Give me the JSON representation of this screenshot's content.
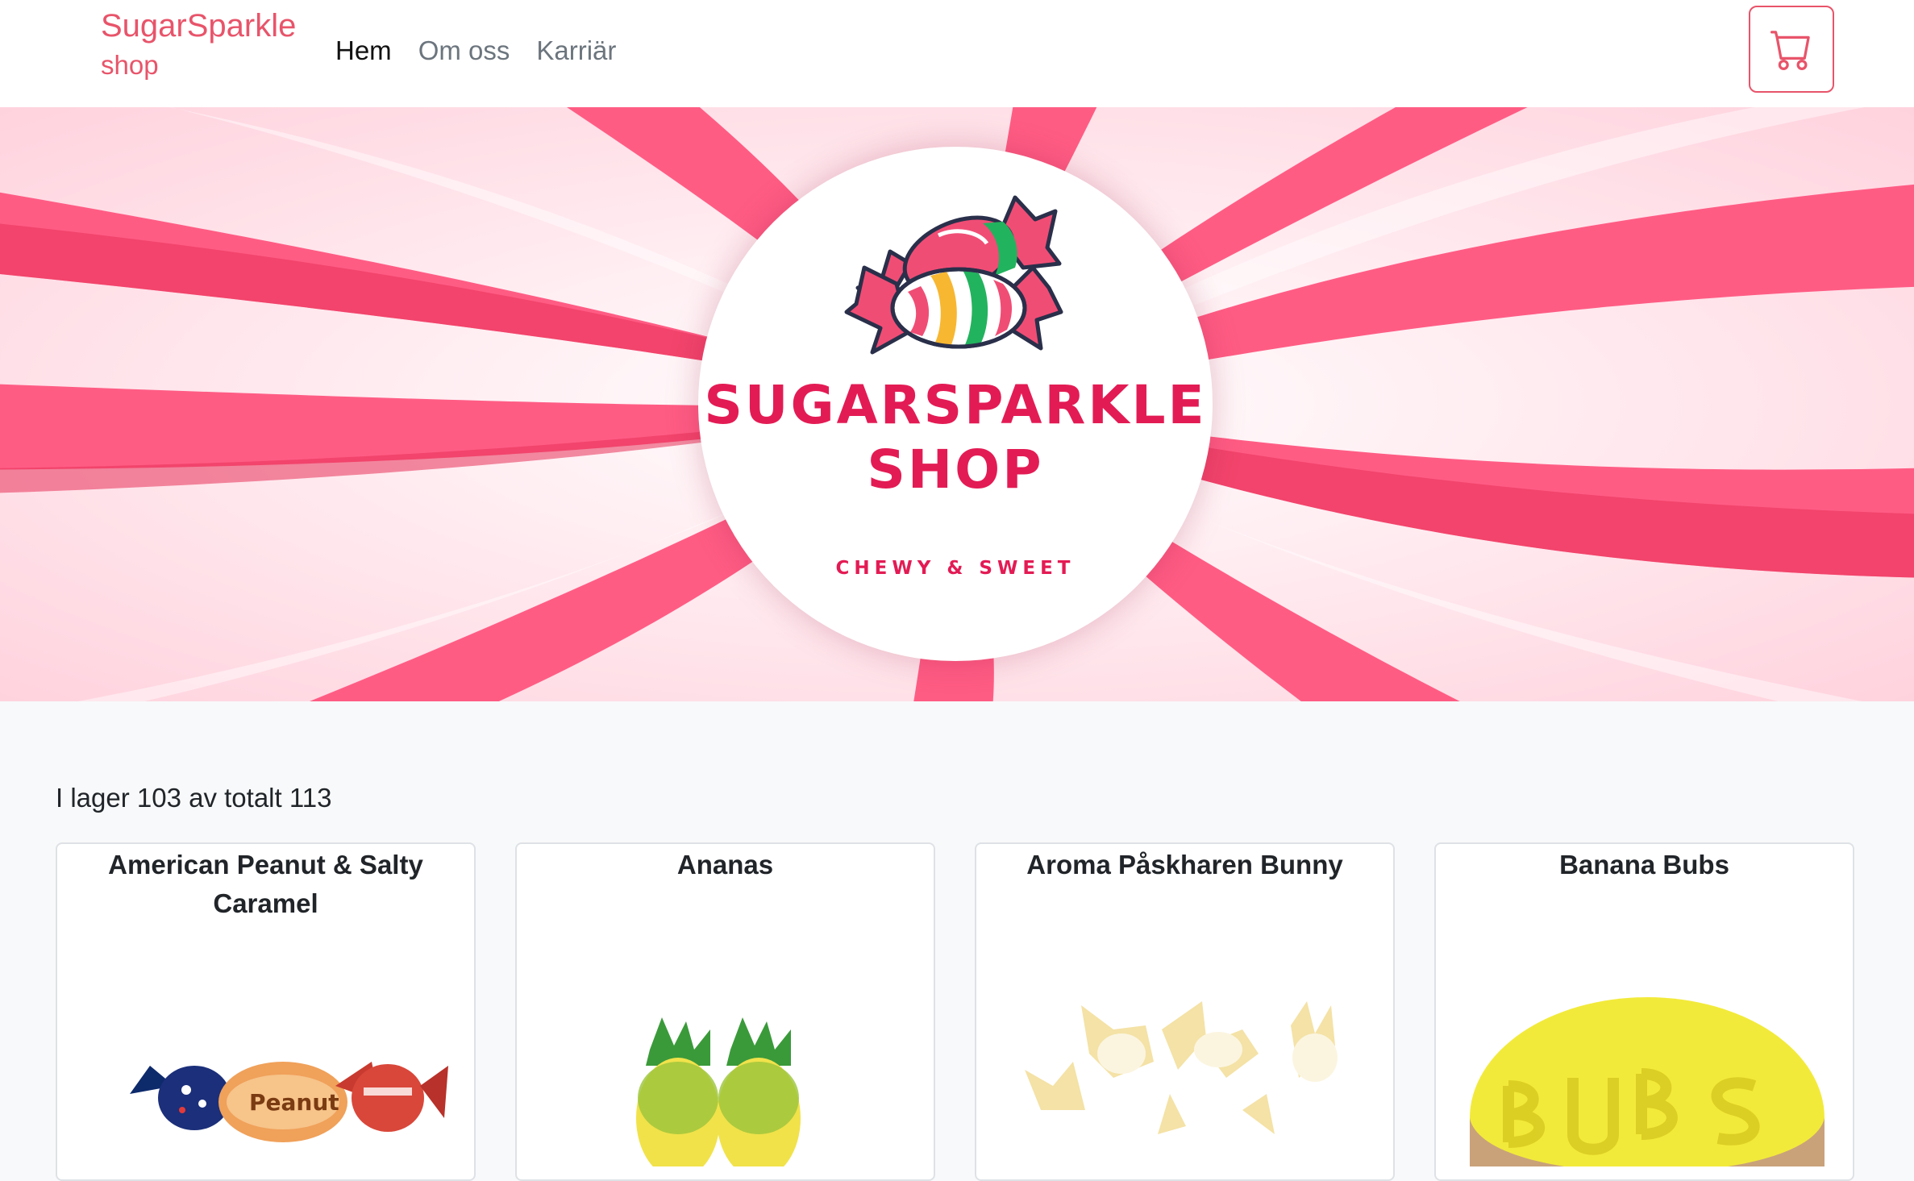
{
  "navbar": {
    "brand_top": "SugarSparkle",
    "brand_bottom": "shop",
    "links": [
      {
        "label": "Hem",
        "active": true
      },
      {
        "label": "Om oss",
        "active": false
      },
      {
        "label": "Karriär",
        "active": false
      }
    ],
    "cart_icon": "shopping-cart-icon"
  },
  "hero": {
    "logo_line1": "SUGARSPARKLE",
    "logo_line2": "SHOP",
    "logo_tagline": "CHEWY & SWEET"
  },
  "stock": {
    "text": "I lager 103 av totalt 113"
  },
  "products": [
    {
      "title": "American Peanut & Salty Caramel"
    },
    {
      "title": "Ananas"
    },
    {
      "title": "Aroma Påskharen Bunny"
    },
    {
      "title": "Banana Bubs"
    }
  ],
  "colors": {
    "brand": "#e8546a",
    "logo_red": "#e31b54",
    "swirl_pink": "#ff5c84"
  }
}
